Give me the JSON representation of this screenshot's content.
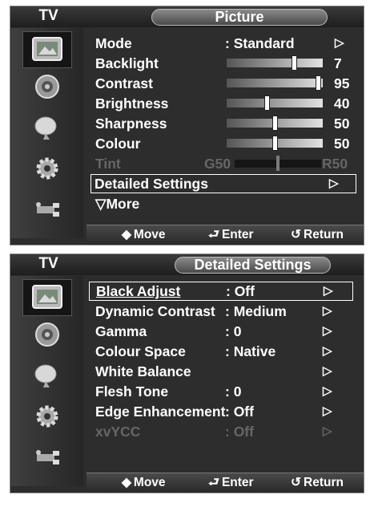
{
  "screens": [
    {
      "tv_label": "TV",
      "title": "Picture",
      "menu": {
        "mode": {
          "label": "Mode",
          "value": ": Standard",
          "arrow": "▷"
        },
        "backlight": {
          "label": "Backlight",
          "value": "7",
          "level": 0.7
        },
        "contrast": {
          "label": "Contrast",
          "value": "95",
          "level": 0.95
        },
        "brightness": {
          "label": "Brightness",
          "value": "40",
          "level": 0.42
        },
        "sharpness": {
          "label": "Sharpness",
          "value": "50",
          "level": 0.5
        },
        "colour": {
          "label": "Colour",
          "value": "50",
          "level": 0.5
        },
        "tint": {
          "label": "Tint",
          "left": "G50",
          "right": "R50"
        },
        "detailed": {
          "label": "Detailed Settings",
          "arrow": "▷"
        },
        "more": {
          "label": "▽More"
        }
      }
    },
    {
      "tv_label": "TV",
      "title": "Detailed Settings",
      "menu": {
        "black_adjust": {
          "label": "Black Adjust",
          "value": ": Off",
          "arrow": "▷"
        },
        "dynamic_contrast": {
          "label": "Dynamic Contrast",
          "value": ": Medium",
          "arrow": "▷"
        },
        "gamma": {
          "label": "Gamma",
          "value": ": 0",
          "arrow": "▷"
        },
        "colour_space": {
          "label": "Colour Space",
          "value": ": Native",
          "arrow": "▷"
        },
        "white_balance": {
          "label": "White Balance",
          "arrow": "▷"
        },
        "flesh_tone": {
          "label": "Flesh Tone",
          "value": ": 0",
          "arrow": "▷"
        },
        "edge_enhancement": {
          "label": "Edge Enhancement",
          "value": ": Off",
          "arrow": "▷"
        },
        "xvycc": {
          "label": "xvYCC",
          "value": ": Off",
          "arrow": "▷"
        }
      }
    }
  ],
  "hints": {
    "move": {
      "glyph": "◆",
      "label": "Move"
    },
    "enter": {
      "glyph": "⮐",
      "label": "Enter"
    },
    "return": {
      "glyph": "↺",
      "label": "Return"
    }
  },
  "sidebar_icons": [
    "picture-icon",
    "sound-icon",
    "channel-icon",
    "setup-icon",
    "input-icon"
  ]
}
